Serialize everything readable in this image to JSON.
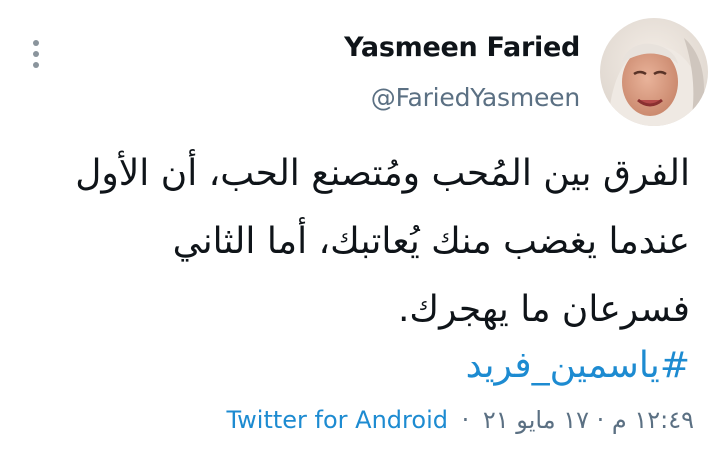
{
  "tweet": {
    "author": {
      "display_name": "Yasmeen Faried",
      "handle": "@FariedYasmeen"
    },
    "body_lines": [
      "الفرق بين المُحب ومُتصنع الحب، أن الأول",
      "عندما يغضب منك يُعاتبك، أما الثاني",
      "فسرعان ما يهجرك."
    ],
    "hashtag": "#ياسمين_فريد",
    "timestamp": "١٢:٤٩ م · ١٧ مايو ٢١",
    "separator": "·",
    "source": "Twitter for Android"
  },
  "icons": {
    "more": "more-vertical-icon"
  },
  "colors": {
    "link": "#1d8bd1",
    "secondary_text": "#5b7083",
    "primary_text": "#0f1419",
    "background": "#ffffff"
  }
}
